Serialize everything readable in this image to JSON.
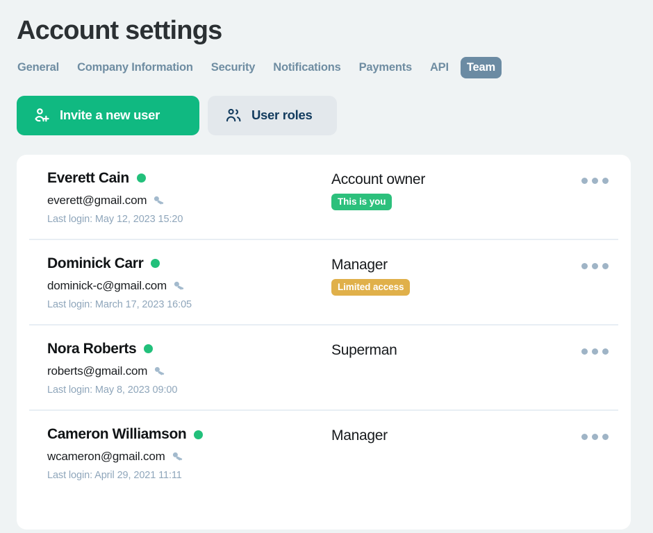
{
  "header": {
    "title": "Account settings",
    "tabs": [
      {
        "label": "General",
        "active": false
      },
      {
        "label": "Company Information",
        "active": false
      },
      {
        "label": "Security",
        "active": false
      },
      {
        "label": "Notifications",
        "active": false
      },
      {
        "label": "Payments",
        "active": false
      },
      {
        "label": "API",
        "active": false
      },
      {
        "label": "Team",
        "active": true
      }
    ]
  },
  "actions": {
    "invite_label": "Invite a new user",
    "invite_icon": "user-plus-icon",
    "roles_label": "User roles",
    "roles_icon": "users-group-icon"
  },
  "colors": {
    "primary_green": "#10b981",
    "badge_green": "#2cc07c",
    "badge_amber": "#e0b04a",
    "status_dot": "#22c07b",
    "active_tab": "#6b8ba3",
    "tab_text": "#6f8da2",
    "page_background": "#eff3f4"
  },
  "team": {
    "members": [
      {
        "name": "Everett Cain",
        "status": "online",
        "email": "everett@gmail.com",
        "email_icon": "key-icon",
        "last_login": "Last login: May 12, 2023 15:20",
        "role": "Account owner",
        "badge": "This is you",
        "badge_style": "green",
        "menu_icon": "more-horizontal-icon"
      },
      {
        "name": "Dominick Carr",
        "status": "online",
        "email": "dominick-c@gmail.com",
        "email_icon": "key-icon",
        "last_login": "Last login: March 17, 2023 16:05",
        "role": "Manager",
        "badge": "Limited access",
        "badge_style": "amber",
        "menu_icon": "more-horizontal-icon"
      },
      {
        "name": "Nora Roberts",
        "status": "online",
        "email": "roberts@gmail.com",
        "email_icon": "key-icon",
        "last_login": "Last login: May 8, 2023 09:00",
        "role": "Superman",
        "badge": "",
        "badge_style": "hidden",
        "menu_icon": "more-horizontal-icon"
      },
      {
        "name": "Cameron Williamson",
        "status": "online",
        "email": "wcameron@gmail.com",
        "email_icon": "key-icon",
        "last_login": "Last login: April 29, 2021 11:11",
        "role": "Manager",
        "badge": "",
        "badge_style": "hidden",
        "menu_icon": "more-horizontal-icon"
      }
    ]
  }
}
